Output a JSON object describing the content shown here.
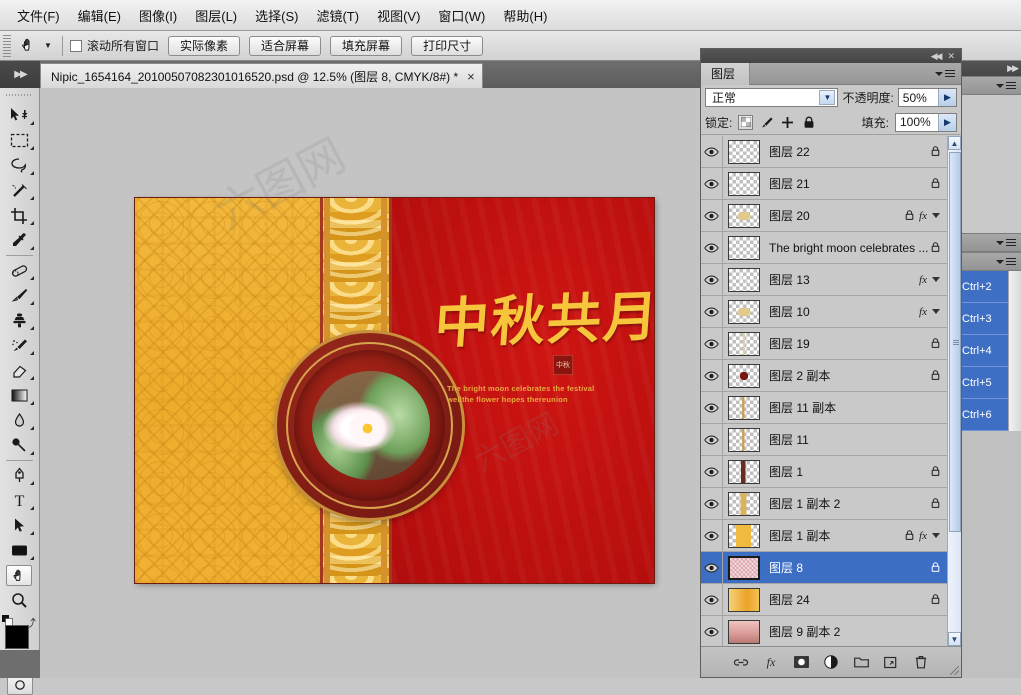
{
  "menubar": {
    "items": [
      {
        "label": "文件(F)"
      },
      {
        "label": "编辑(E)"
      },
      {
        "label": "图像(I)"
      },
      {
        "label": "图层(L)"
      },
      {
        "label": "选择(S)"
      },
      {
        "label": "滤镜(T)"
      },
      {
        "label": "视图(V)"
      },
      {
        "label": "窗口(W)"
      },
      {
        "label": "帮助(H)"
      }
    ]
  },
  "options_bar": {
    "active_tool": "hand-tool",
    "scroll_all_windows_label": "滚动所有窗口",
    "scroll_all_windows_checked": false,
    "buttons": [
      {
        "label": "实际像素"
      },
      {
        "label": "适合屏幕"
      },
      {
        "label": "填充屏幕"
      },
      {
        "label": "打印尺寸"
      }
    ]
  },
  "document_tab": {
    "title": "Nipic_1654164_20100507082301016520.psd @ 12.5% (图层 8, CMYK/8#) *",
    "close_label": "×",
    "zoom": "12.5%",
    "color_mode": "CMYK/8#",
    "active_layer": "图层 8"
  },
  "toolbar": {
    "tools": [
      {
        "name": "move-tool",
        "glyph": "move"
      },
      {
        "name": "marquee-tool",
        "glyph": "marquee"
      },
      {
        "name": "lasso-tool",
        "glyph": "lasso"
      },
      {
        "name": "magic-wand-tool",
        "glyph": "wand"
      },
      {
        "name": "crop-tool",
        "glyph": "crop"
      },
      {
        "name": "eyedropper-tool",
        "glyph": "eyedropper"
      },
      {
        "name": "healing-brush-tool",
        "glyph": "healing"
      },
      {
        "name": "brush-tool",
        "glyph": "brush"
      },
      {
        "name": "clone-stamp-tool",
        "glyph": "stamp"
      },
      {
        "name": "history-brush-tool",
        "glyph": "history"
      },
      {
        "name": "eraser-tool",
        "glyph": "eraser"
      },
      {
        "name": "gradient-tool",
        "glyph": "gradient"
      },
      {
        "name": "blur-tool",
        "glyph": "blur"
      },
      {
        "name": "dodge-tool",
        "glyph": "dodge"
      },
      {
        "name": "pen-tool",
        "glyph": "pen"
      },
      {
        "name": "type-tool",
        "glyph": "T"
      },
      {
        "name": "path-selection-tool",
        "glyph": "arrow"
      },
      {
        "name": "shape-tool",
        "glyph": "rect"
      },
      {
        "name": "hand-tool",
        "glyph": "hand"
      },
      {
        "name": "zoom-tool",
        "glyph": "zoom"
      }
    ],
    "foreground_color": "#000000",
    "background_color": "#ffffff"
  },
  "canvas": {
    "artwork_title": "中秋共月",
    "artwork_subtitle": "The bright moon celebrates the festival wellthe flower hopes thereunion",
    "seal_text": "中秋",
    "background_red": "#c21411",
    "background_gold": "#efae2e"
  },
  "layers_panel": {
    "tab_label": "图层",
    "blend_mode": "正常",
    "opacity_label": "不透明度:",
    "opacity_value": "50%",
    "lock_label": "锁定:",
    "fill_label": "填充:",
    "fill_value": "100%",
    "lock_icons": [
      "lock-transparent-pixels",
      "lock-image-pixels",
      "lock-position",
      "lock-all"
    ],
    "layers": [
      {
        "name": "图层 22",
        "visible": true,
        "locked": true,
        "fx": false,
        "selected": false,
        "thumb": "t-empty"
      },
      {
        "name": "图层 21",
        "visible": true,
        "locked": true,
        "fx": false,
        "selected": false,
        "thumb": "t-empty"
      },
      {
        "name": "图层 20",
        "visible": true,
        "locked": true,
        "fx": true,
        "selected": false,
        "thumb": "t-gold"
      },
      {
        "name": "The bright moon celebrates ...",
        "visible": true,
        "locked": true,
        "fx": false,
        "selected": false,
        "thumb": "t-empty"
      },
      {
        "name": "图层 13",
        "visible": true,
        "locked": false,
        "fx": true,
        "selected": false,
        "thumb": "t-spark"
      },
      {
        "name": "图层 10",
        "visible": true,
        "locked": false,
        "fx": true,
        "selected": false,
        "thumb": "t-gold"
      },
      {
        "name": "图层 19",
        "visible": true,
        "locked": true,
        "fx": false,
        "selected": false,
        "thumb": "t-sliver"
      },
      {
        "name": "图层 2 副本",
        "visible": true,
        "locked": true,
        "fx": false,
        "selected": false,
        "thumb": "t-dot"
      },
      {
        "name": "图层 11 副本",
        "visible": true,
        "locked": false,
        "fx": false,
        "selected": false,
        "thumb": "t-thin"
      },
      {
        "name": "图层 11",
        "visible": true,
        "locked": false,
        "fx": false,
        "selected": false,
        "thumb": "t-thin"
      },
      {
        "name": "图层 1",
        "visible": true,
        "locked": true,
        "fx": false,
        "selected": false,
        "thumb": "t-bar-d"
      },
      {
        "name": "图层 1 副本 2",
        "visible": true,
        "locked": true,
        "fx": false,
        "selected": false,
        "thumb": "t-bar-g"
      },
      {
        "name": "图层 1 副本",
        "visible": true,
        "locked": true,
        "fx": true,
        "selected": false,
        "thumb": "t-bar-gold"
      },
      {
        "name": "图层 8",
        "visible": true,
        "locked": true,
        "fx": false,
        "selected": true,
        "thumb": "t-noise"
      },
      {
        "name": "图层 24",
        "visible": true,
        "locked": true,
        "fx": false,
        "selected": false,
        "thumb": "t-grad"
      },
      {
        "name": "图层 9 副本 2",
        "visible": true,
        "locked": false,
        "fx": false,
        "selected": false,
        "thumb": "t-pink"
      }
    ],
    "footer_buttons": [
      {
        "name": "link-layers-button",
        "glyph": "⚭"
      },
      {
        "name": "layer-style-button",
        "glyph": "fx"
      },
      {
        "name": "add-mask-button",
        "glyph": "□"
      },
      {
        "name": "adjustment-layer-button",
        "glyph": "◑"
      },
      {
        "name": "new-group-button",
        "glyph": "▭"
      },
      {
        "name": "new-layer-button",
        "glyph": "⧉"
      },
      {
        "name": "delete-layer-button",
        "glyph": "🗑"
      }
    ]
  },
  "channels_dock": {
    "rows": [
      {
        "shortcut": "Ctrl+2"
      },
      {
        "shortcut": "Ctrl+3"
      },
      {
        "shortcut": "Ctrl+4"
      },
      {
        "shortcut": "Ctrl+5"
      },
      {
        "shortcut": "Ctrl+6"
      }
    ]
  },
  "watermarks": {
    "mark_a": "六图网",
    "mark_b": "六图网"
  }
}
